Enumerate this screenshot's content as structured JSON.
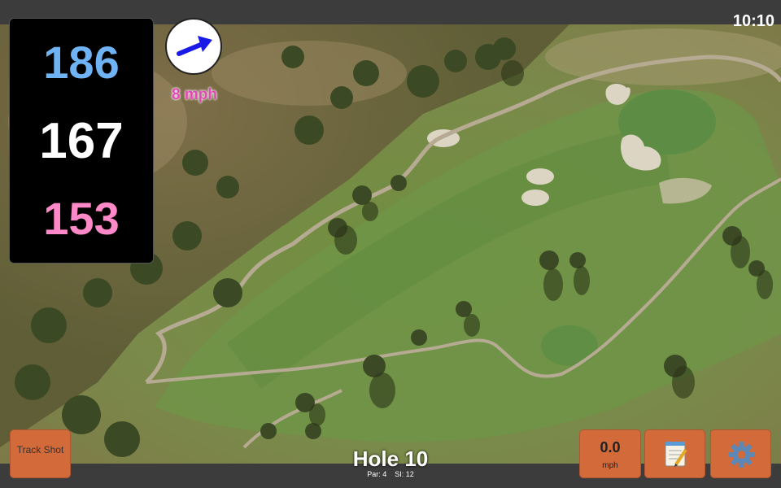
{
  "status": {
    "time": "10:10"
  },
  "distances": {
    "back": "186",
    "middle": "167",
    "front": "153"
  },
  "wind": {
    "speed": "8 mph",
    "icon": "wind-direction-arrow-icon"
  },
  "hole": {
    "title": "Hole 10",
    "par": "Par: 4",
    "si": "SI: 12"
  },
  "buttons": {
    "track_shot": "Track Shot",
    "speed_value": "0.0",
    "speed_unit": "mph",
    "notes_icon": "notepad-icon",
    "settings_icon": "gear-icon"
  },
  "colors": {
    "back_distance": "#6fb3f5",
    "middle_distance": "#ffffff",
    "front_distance": "#ff88c8",
    "wind_text": "#e04ab4",
    "button": "#d26a3a"
  }
}
